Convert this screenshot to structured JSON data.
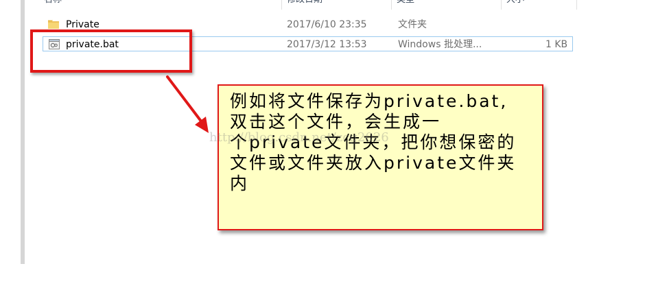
{
  "file_list": {
    "header": {
      "columns": [
        "名称",
        "修改日期",
        "类型",
        "大小"
      ]
    },
    "rows": [
      {
        "name": "Private",
        "modified": "2017/6/10 23:35",
        "type": "文件夹",
        "size": "",
        "icon": "folder-icon"
      },
      {
        "name": "private.bat",
        "modified": "2017/3/12 13:53",
        "type": "Windows 批处理...",
        "size": "1 KB",
        "icon": "bat-file-icon"
      }
    ]
  },
  "annotation": {
    "lines": [
      "例如将文件保存为private.bat,",
      "双击这个文件，会生成一",
      "个private文件夹，把你想保密的",
      "文件或文件夹放入private文件夹",
      "内"
    ],
    "box_color": "#e01818",
    "callout_bg": "#ffffc4"
  },
  "watermark": "http://blog.csdn.net/zcg2026"
}
